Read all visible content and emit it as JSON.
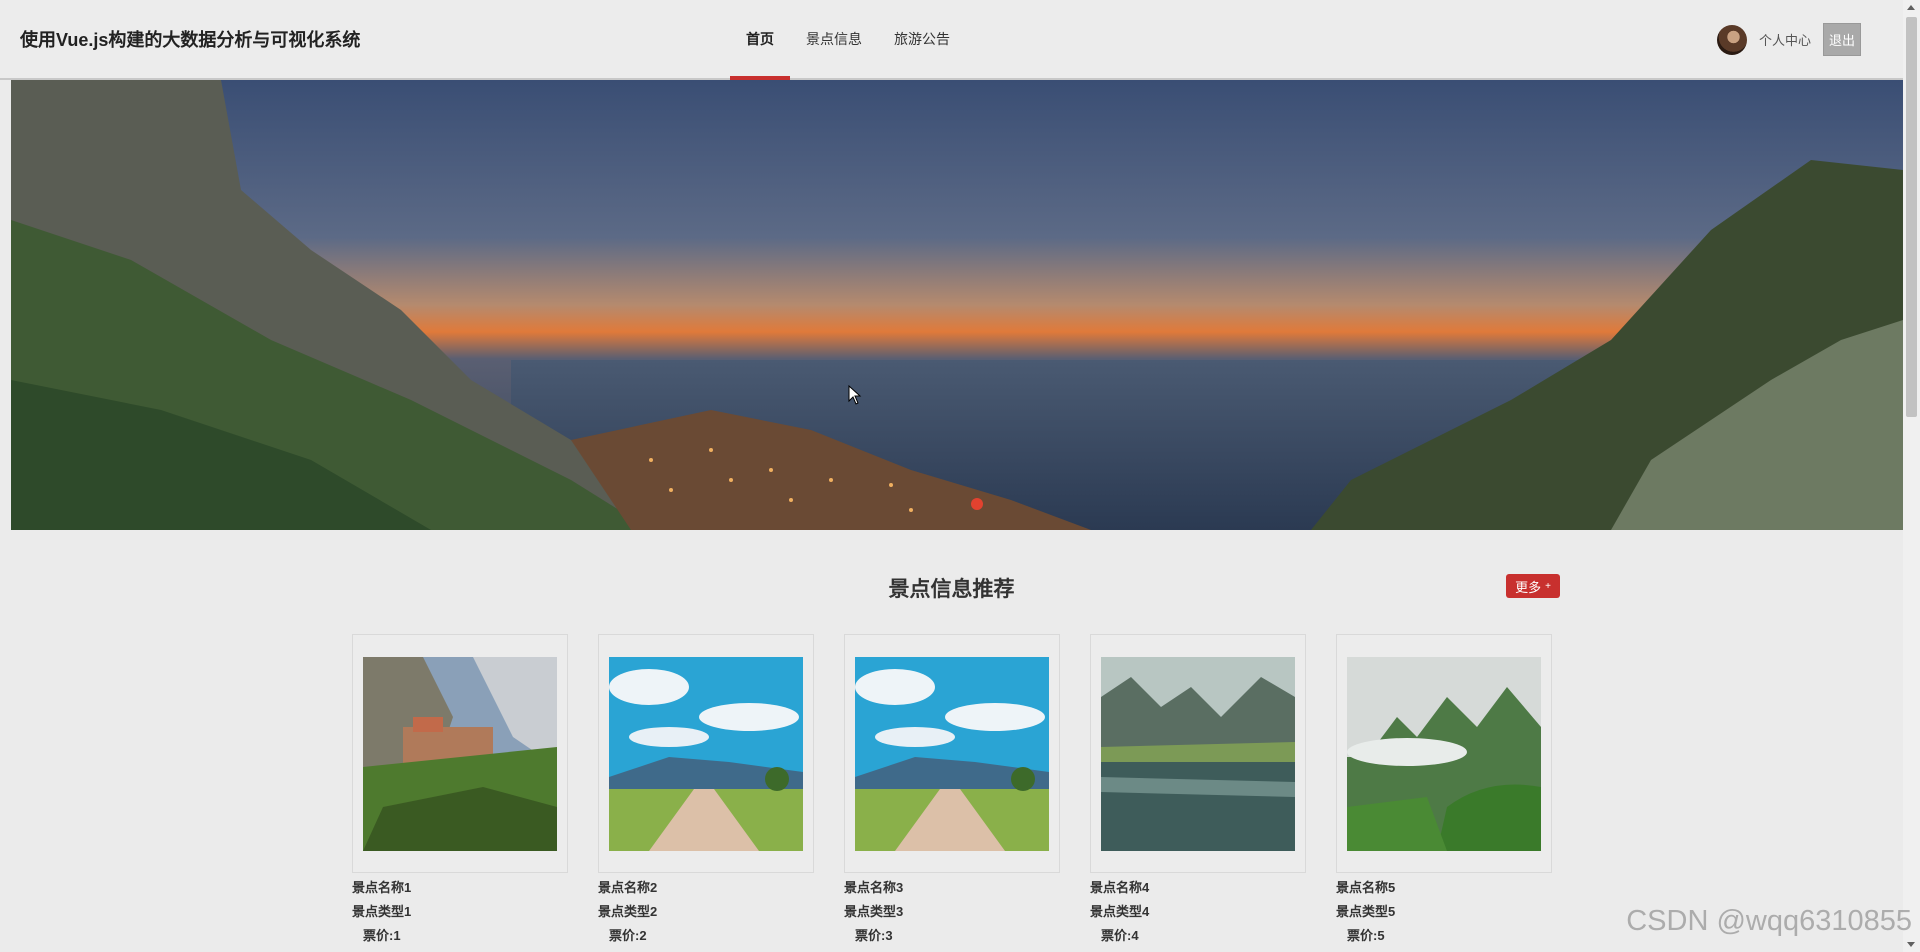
{
  "header": {
    "site_title": "使用Vue.js构建的大数据分析与可视化系统",
    "nav": [
      {
        "label": "首页",
        "active": true
      },
      {
        "label": "景点信息",
        "active": false
      },
      {
        "label": "旅游公告",
        "active": false
      }
    ],
    "profile_label": "个人中心",
    "logout_label": "退出",
    "accent_color": "#c8302e"
  },
  "banner": {
    "icons": [
      "carousel-dot-icon",
      "mouse-cursor-icon"
    ]
  },
  "recommend": {
    "title": "景点信息推荐",
    "more_label": "更多",
    "more_icon": "plus-icon",
    "items": [
      {
        "name": "景点名称1",
        "type": "景点类型1",
        "price": "票价:1"
      },
      {
        "name": "景点名称2",
        "type": "景点类型2",
        "price": "票价:2"
      },
      {
        "name": "景点名称3",
        "type": "景点类型3",
        "price": "票价:3"
      },
      {
        "name": "景点名称4",
        "type": "景点类型4",
        "price": "票价:4"
      },
      {
        "name": "景点名称5",
        "type": "景点类型5",
        "price": "票价:5"
      }
    ]
  },
  "watermark": "CSDN @wqq6310855"
}
